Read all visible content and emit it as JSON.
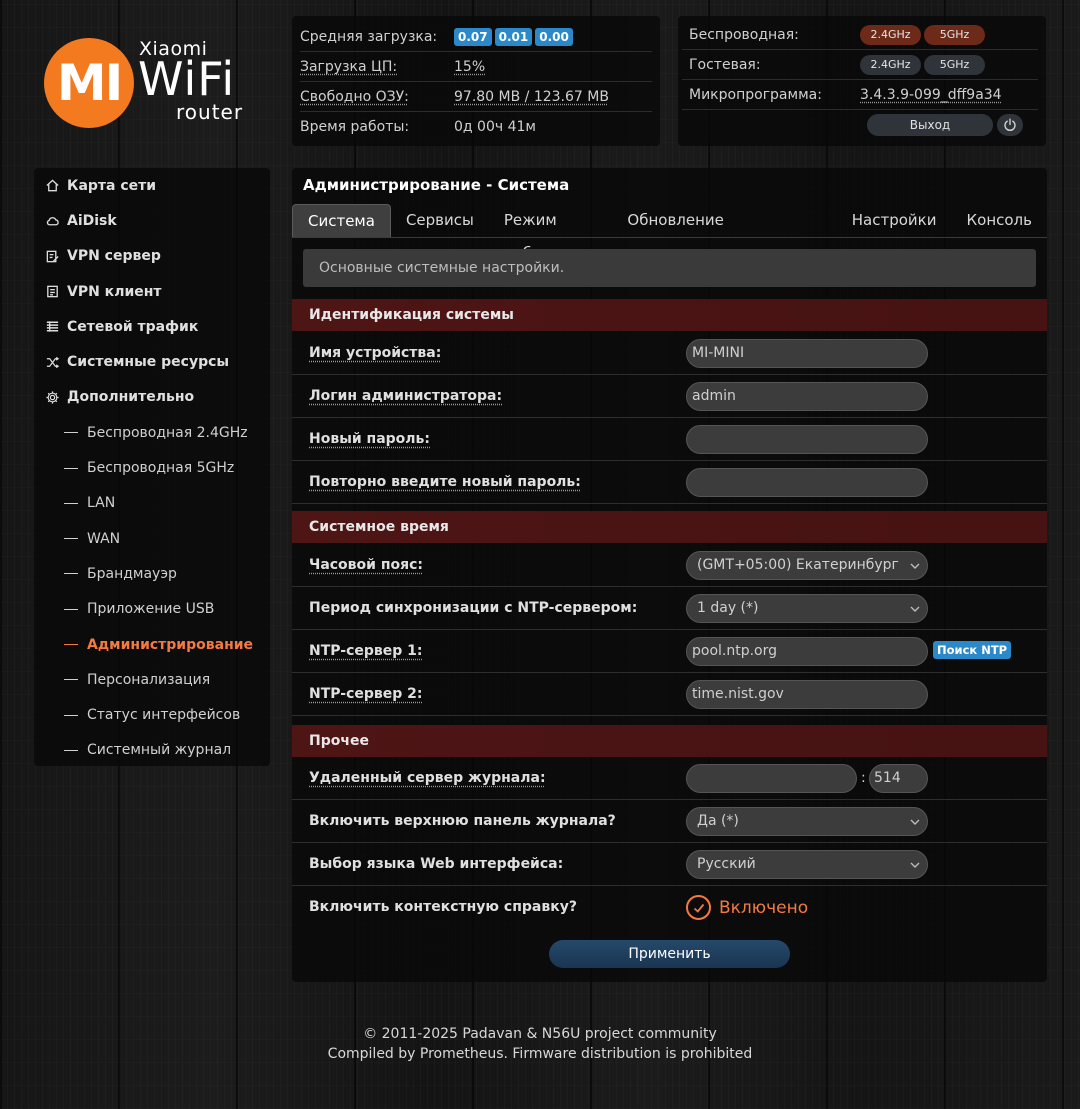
{
  "logo": {
    "mark": "MI",
    "brand": "Xiaomi",
    "product": "WiFi",
    "subtitle": "router"
  },
  "status": {
    "load_label": "Средняя загрузка:",
    "load_values": [
      "0.07",
      "0.01",
      "0.00"
    ],
    "cpu_label": "Загрузка ЦП:",
    "cpu_value": "15%",
    "ram_label": "Свободно ОЗУ:",
    "ram_value": "97.80 MB / 123.67 MB",
    "uptime_label": "Время работы:",
    "uptime_value": "0д 00ч 41м"
  },
  "wireless": {
    "wireless_label": "Беспроводная:",
    "guest_label": "Гостевая:",
    "firmware_label": "Микропрограмма:",
    "firmware_value": "3.4.3.9-099_dff9a34",
    "band_24": "2.4GHz",
    "band_5": "5GHz",
    "logout_label": "Выход",
    "colors": {
      "active_band": "#6d2a18",
      "inactive_band": "#2f343b"
    }
  },
  "sidebar": {
    "items": [
      {
        "label": "Карта сети",
        "icon": "home-icon"
      },
      {
        "label": "AiDisk",
        "icon": "cloud-icon"
      },
      {
        "label": "VPN сервер",
        "icon": "vpn-server-icon"
      },
      {
        "label": "VPN клиент",
        "icon": "vpn-client-icon"
      },
      {
        "label": "Сетевой трафик",
        "icon": "traffic-icon"
      },
      {
        "label": "Системные ресурсы",
        "icon": "shuffle-icon"
      },
      {
        "label": "Дополнительно",
        "icon": "gear-icon"
      }
    ],
    "subitems": [
      "Беспроводная 2.4GHz",
      "Беспроводная 5GHz",
      "LAN",
      "WAN",
      "Брандмауэр",
      "Приложение USB",
      "Администрирование",
      "Персонализация",
      "Статус интерфейсов",
      "Системный журнал"
    ],
    "active_subitem": "Администрирование",
    "accent_color": "#f47a42"
  },
  "main": {
    "title": "Администрирование - Система",
    "tabs": [
      "Система",
      "Сервисы",
      "Режим работы",
      "Обновление микропрограммы",
      "Настройки",
      "Консоль"
    ],
    "active_tab": "Система",
    "info": "Основные системные настройки.",
    "sections": {
      "identity": "Идентификация системы",
      "time": "Системное время",
      "other": "Прочее"
    },
    "fields": {
      "device_name_label": "Имя устройства:",
      "device_name_value": "MI-MINI",
      "admin_login_label": "Логин администратора:",
      "admin_login_value": "admin",
      "new_password_label": "Новый пароль:",
      "new_password_value": "",
      "repeat_password_label": "Повторно введите новый пароль:",
      "repeat_password_value": "",
      "timezone_label": "Часовой пояс:",
      "timezone_value": "(GMT+05:00) Екатеринбург",
      "ntp_period_label": "Период синхронизации с NTP-сервером:",
      "ntp_period_value": "1 day (*)",
      "ntp1_label": "NTP-сервер 1:",
      "ntp1_value": "pool.ntp.org",
      "ntp_search_label": "Поиск NTP",
      "ntp2_label": "NTP-сервер 2:",
      "ntp2_value": "time.nist.gov",
      "remote_log_label": "Удаленный сервер журнала:",
      "remote_log_host": "",
      "remote_log_sep": ":",
      "remote_log_port": "514",
      "log_panel_label": "Включить верхнюю панель журнала?",
      "log_panel_value": "Да (*)",
      "lang_label": "Выбор языка Web интерфейса:",
      "lang_value": "Русский",
      "help_label": "Включить контекстную справку?",
      "help_value": "Включено"
    },
    "apply_label": "Применить"
  },
  "footer": {
    "line1": "© 2011-2025 Padavan & N56U project community",
    "line2": "Compiled by Prometheus. Firmware distribution is prohibited"
  }
}
